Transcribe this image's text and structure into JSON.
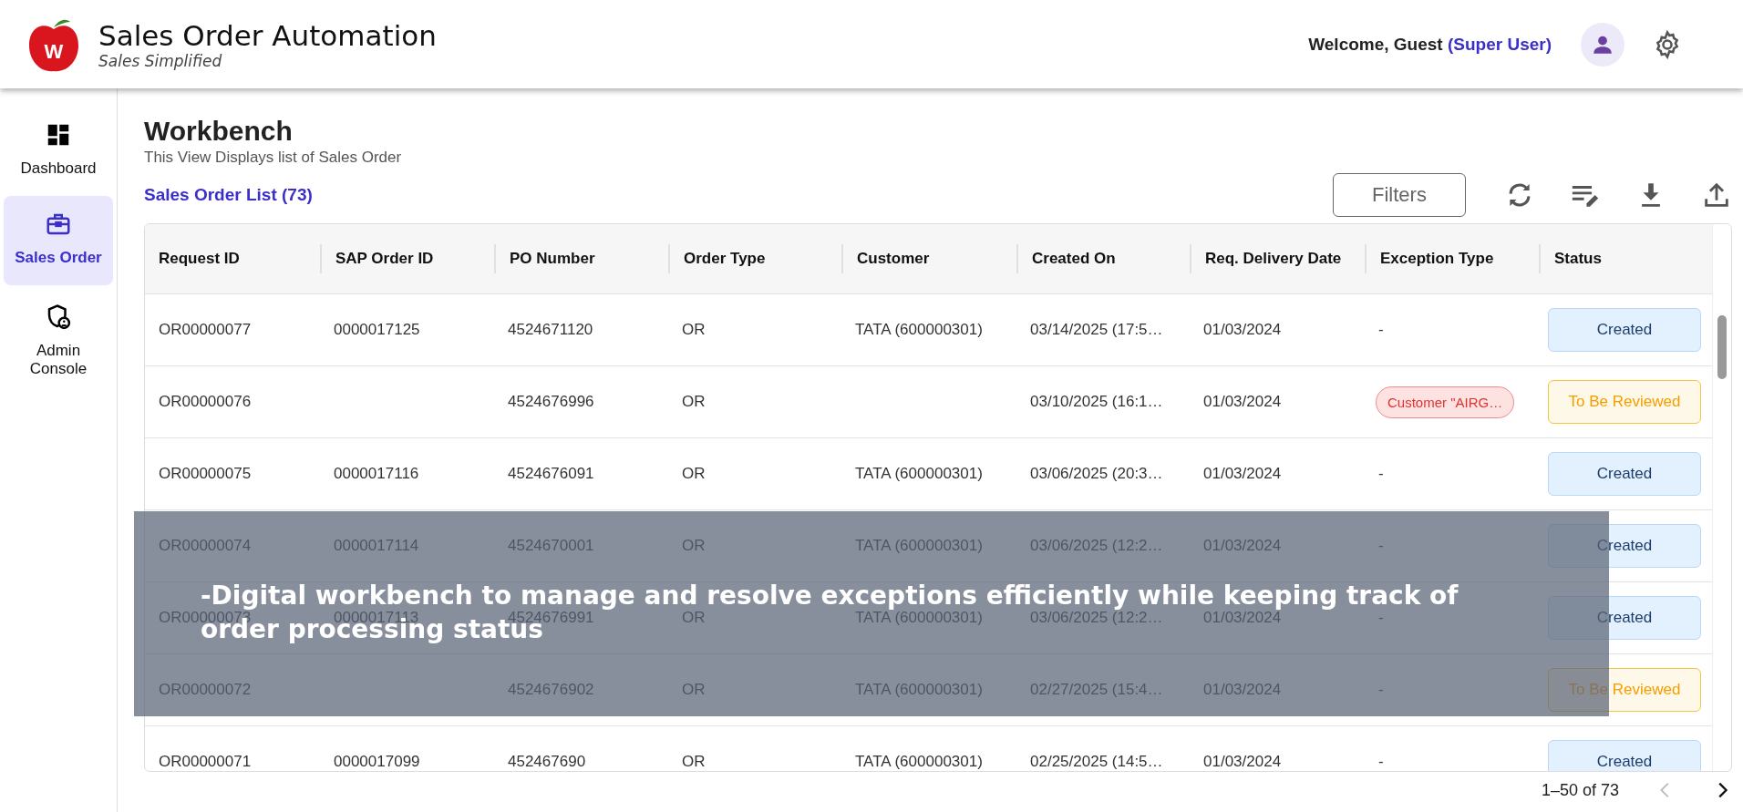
{
  "header": {
    "title": "Sales Order Automation",
    "subtitle": "Sales Simplified",
    "logo_letter": "W",
    "welcome": "Welcome, Guest",
    "role": "(Super User)"
  },
  "sidebar": {
    "items": [
      {
        "label": "Dashboard",
        "kind": "dashboard",
        "selected": false
      },
      {
        "label": "Sales Order",
        "kind": "sales",
        "selected": true
      },
      {
        "label": "Admin Console",
        "kind": "admin",
        "selected": false
      }
    ]
  },
  "page": {
    "title": "Workbench",
    "subtitle": "This View Displays list of Sales Order",
    "list_title": "Sales Order List (73)",
    "filters_button": "Filters"
  },
  "table": {
    "columns": [
      "Request ID",
      "SAP Order ID",
      "PO Number",
      "Order Type",
      "Customer",
      "Created On",
      "Req. Delivery Date",
      "Exception Type",
      "Status"
    ],
    "rows": [
      {
        "cells": [
          "OR00000077",
          "0000017125",
          "4524671120",
          "OR",
          "TATA (600000301)",
          "03/14/2025 (17:5…",
          "01/03/2024"
        ],
        "exception": {
          "text": "-",
          "kind": "none"
        },
        "status": {
          "text": "Created",
          "kind": "created"
        }
      },
      {
        "cells": [
          "OR00000076",
          "",
          "4524676996",
          "OR",
          "",
          "03/10/2025 (16:1…",
          "01/03/2024"
        ],
        "exception": {
          "text": "Customer \"AIRG…",
          "kind": "error"
        },
        "status": {
          "text": "To Be Reviewed",
          "kind": "review"
        }
      },
      {
        "cells": [
          "OR00000075",
          "0000017116",
          "4524676091",
          "OR",
          "TATA (600000301)",
          "03/06/2025 (20:3…",
          "01/03/2024"
        ],
        "exception": {
          "text": "-",
          "kind": "none"
        },
        "status": {
          "text": "Created",
          "kind": "created"
        }
      },
      {
        "cells": [
          "OR00000074",
          "0000017114",
          "4524670001",
          "OR",
          "TATA (600000301)",
          "03/06/2025 (12:2…",
          "01/03/2024"
        ],
        "exception": {
          "text": "-",
          "kind": "none"
        },
        "status": {
          "text": "Created",
          "kind": "created"
        }
      },
      {
        "cells": [
          "OR00000073",
          "0000017113",
          "4524676991",
          "OR",
          "TATA (600000301)",
          "03/06/2025 (12:2…",
          "01/03/2024"
        ],
        "exception": {
          "text": "-",
          "kind": "none"
        },
        "status": {
          "text": "Created",
          "kind": "created"
        }
      },
      {
        "cells": [
          "OR00000072",
          "",
          "4524676902",
          "OR",
          "TATA (600000301)",
          "02/27/2025 (15:4…",
          "01/03/2024"
        ],
        "exception": {
          "text": "-",
          "kind": "none"
        },
        "status": {
          "text": "To Be Reviewed",
          "kind": "review"
        }
      },
      {
        "cells": [
          "OR00000071",
          "0000017099",
          "452467690",
          "OR",
          "TATA (600000301)",
          "02/25/2025 (14:5…",
          "01/03/2024"
        ],
        "exception": {
          "text": "-",
          "kind": "none"
        },
        "status": {
          "text": "Created",
          "kind": "created"
        }
      }
    ]
  },
  "pagination": {
    "range": "1–50 of 73"
  },
  "caption": "-Digital workbench to manage and resolve exceptions efficiently while keeping track of order processing status"
}
